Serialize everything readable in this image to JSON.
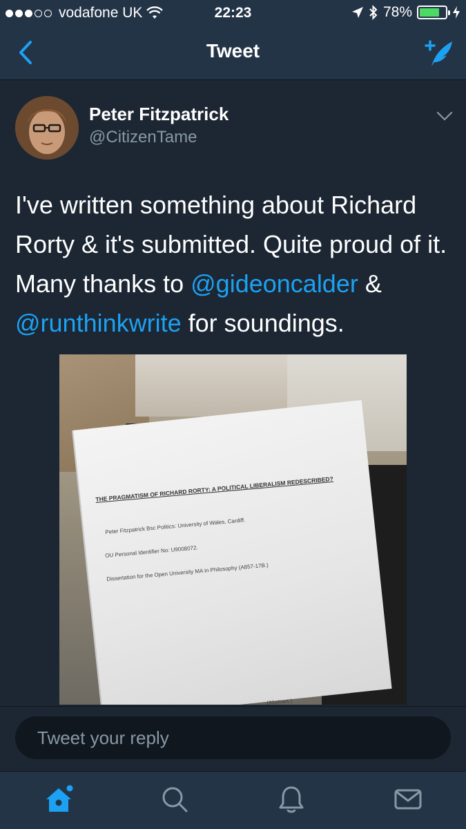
{
  "status_bar": {
    "carrier": "vodafone UK",
    "time": "22:23",
    "battery_percent": "78%",
    "battery_level": 0.78,
    "signal_bars_filled": 3,
    "signal_bars_total": 5
  },
  "nav": {
    "title": "Tweet",
    "back_icon": "chevron-left-icon",
    "compose_icon": "compose-tweet-icon"
  },
  "tweet": {
    "author_name": "Peter Fitzpatrick",
    "author_handle": "@CitizenTame",
    "text_parts": {
      "part1": "I've written something about Richard Rorty & it's submitted. Quite proud of it. Many thanks to ",
      "mention1": "@gideoncalder",
      "part2": " & ",
      "mention2": "@runthinkwrite",
      "part3": " for soundings."
    },
    "photo_doc": {
      "title": "THE PRAGMATISM OF RICHARD RORTY: A POLITICAL LIBERALISM REDESCRIBED?",
      "line1": "Peter Fitzpatrick Bsc Politics: University of Wales, Cardiff.",
      "line2": "OU Personal Identifier No: U9008072.",
      "line3": "Dissertation for the Open University MA in Philosophy (A857-17B.)",
      "footer": "(Abstract.)"
    }
  },
  "reply": {
    "placeholder": "Tweet your reply"
  },
  "tab_bar": {
    "tabs": [
      "home-icon",
      "search-icon",
      "notifications-icon",
      "messages-icon"
    ],
    "active": "home-icon"
  },
  "colors": {
    "background": "#1c2733",
    "bar_background": "#243447",
    "accent": "#1da1f2",
    "secondary_text": "#8899a6"
  }
}
